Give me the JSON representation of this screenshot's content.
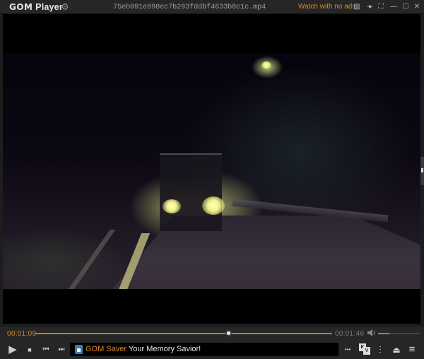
{
  "app": {
    "name_bold": "GOM",
    "name_rest": " Player",
    "filename": "75eb091e898ec7b293fddbf4633b8c1c.mp4",
    "watch_no_ads": "Watch with no ads"
  },
  "titlebar_icons": {
    "settings": "⚙",
    "playlist": "▥",
    "pin": "-▸",
    "fullscreen": "⛶",
    "minimize": "—",
    "maximize": "☐",
    "close": "✕"
  },
  "playback": {
    "current_time": "00:01:09",
    "total_time": "00:01:46",
    "progress_fraction": 0.65,
    "volume_fraction": 0.27,
    "volume_icon": "🔈"
  },
  "controls": {
    "play": "▶",
    "stop": "■",
    "prev": "⏮",
    "next": "⏭",
    "more": "•••",
    "kv_k": "K",
    "kv_v": "V",
    "equalizer": "⫶",
    "eject": "⏏",
    "menu": "≡"
  },
  "ticker": {
    "brand": "GOM Saver",
    "message": " Your Memory Savior!"
  },
  "colors": {
    "accent": "#c27c26",
    "time_current": "#d08a2a",
    "ticker_brand": "#e08a20"
  }
}
